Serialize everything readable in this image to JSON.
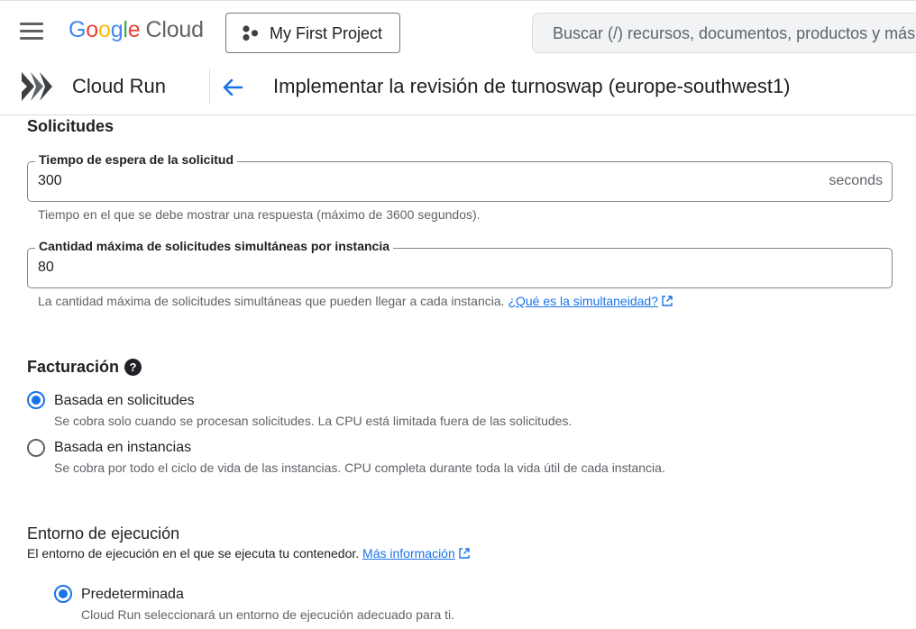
{
  "topbar": {
    "logo_google": [
      "G",
      "o",
      "o",
      "g",
      "l",
      "e"
    ],
    "logo_cloud": "Cloud",
    "project_label": "My First Project",
    "search_placeholder": "Buscar (/) recursos, documentos, productos y más"
  },
  "service": {
    "name": "Cloud Run",
    "page_title": "Implementar la revisión de turnoswap (europe-southwest1)"
  },
  "requests": {
    "title": "Solicitudes",
    "timeout": {
      "label": "Tiempo de espera de la solicitud",
      "value": "300",
      "suffix": "seconds",
      "hint": "Tiempo en el que se debe mostrar una respuesta (máximo de 3600 segundos)."
    },
    "concurrency": {
      "label": "Cantidad máxima de solicitudes simultáneas por instancia",
      "value": "80",
      "hint": "La cantidad máxima de solicitudes simultáneas que pueden llegar a cada instancia.",
      "link": "¿Qué es la simultaneidad?"
    }
  },
  "billing": {
    "title": "Facturación",
    "help_glyph": "?",
    "options": [
      {
        "label": "Basada en solicitudes",
        "desc": "Se cobra solo cuando se procesan solicitudes. La CPU está limitada fuera de las solicitudes.",
        "checked": true
      },
      {
        "label": "Basada en instancias",
        "desc": "Se cobra por todo el ciclo de vida de las instancias. CPU completa durante toda la vida útil de cada instancia.",
        "checked": false
      }
    ]
  },
  "environment": {
    "title": "Entorno de ejecución",
    "desc": "El entorno de ejecución en el que se ejecuta tu contenedor.",
    "link": "Más información",
    "options": [
      {
        "label": "Predeterminada",
        "desc": "Cloud Run seleccionará un entorno de ejecución adecuado para ti.",
        "checked": true
      }
    ]
  },
  "colors": {
    "accent": "#1a73e8",
    "text": "#202124",
    "secondary_text": "#5f6368",
    "border": "#80868b"
  }
}
